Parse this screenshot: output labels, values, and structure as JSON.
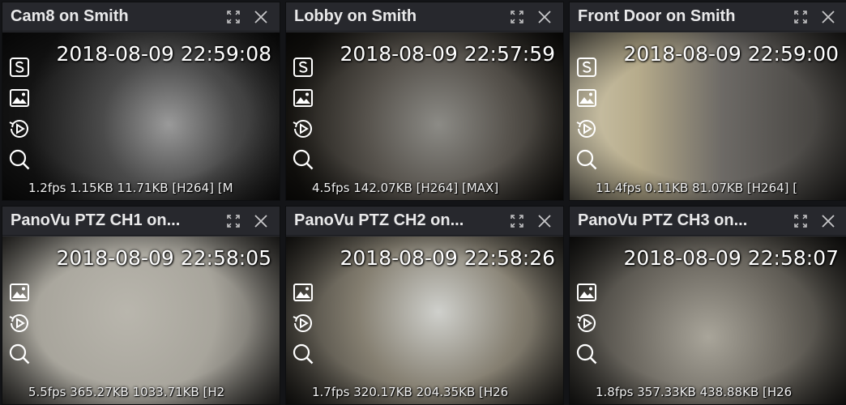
{
  "colors": {
    "panel_bg": "#27282d",
    "title_text": "#e9e9ea",
    "overlay_text": "#ffffff"
  },
  "tiles": [
    {
      "title": "Cam8 on Smith",
      "timestamp": "2018-08-09 22:59:08",
      "stats": "1.2fps 1.15KB 11.71KB [H264] [M",
      "icons": [
        "snapshot-s-icon",
        "image-icon",
        "playback-icon",
        "search-icon"
      ]
    },
    {
      "title": "Lobby on Smith",
      "timestamp": "2018-08-09 22:57:59",
      "stats": "4.5fps 142.07KB [H264] [MAX]",
      "icons": [
        "snapshot-s-icon",
        "image-icon",
        "playback-icon",
        "search-icon"
      ]
    },
    {
      "title": "Front Door on Smith",
      "timestamp": "2018-08-09 22:59:00",
      "stats": "11.4fps 0.11KB 81.07KB [H264] [",
      "icons": [
        "snapshot-s-icon",
        "image-icon",
        "playback-icon",
        "search-icon"
      ]
    },
    {
      "title": "PanoVu PTZ CH1 on...",
      "timestamp": "2018-08-09 22:58:05",
      "stats": "5.5fps 365.27KB 1033.71KB [H2",
      "icons": [
        "image-icon",
        "playback-icon",
        "search-icon"
      ]
    },
    {
      "title": "PanoVu PTZ CH2 on...",
      "timestamp": "2018-08-09 22:58:26",
      "stats": "1.7fps 320.17KB 204.35KB [H26",
      "icons": [
        "image-icon",
        "playback-icon",
        "search-icon"
      ]
    },
    {
      "title": "PanoVu PTZ CH3 on...",
      "timestamp": "2018-08-09 22:58:07",
      "stats": "1.8fps 357.33KB 438.88KB [H26",
      "icons": [
        "image-icon",
        "playback-icon",
        "search-icon"
      ]
    }
  ],
  "titlebar_icons": [
    "fullscreen-icon",
    "close-icon"
  ]
}
